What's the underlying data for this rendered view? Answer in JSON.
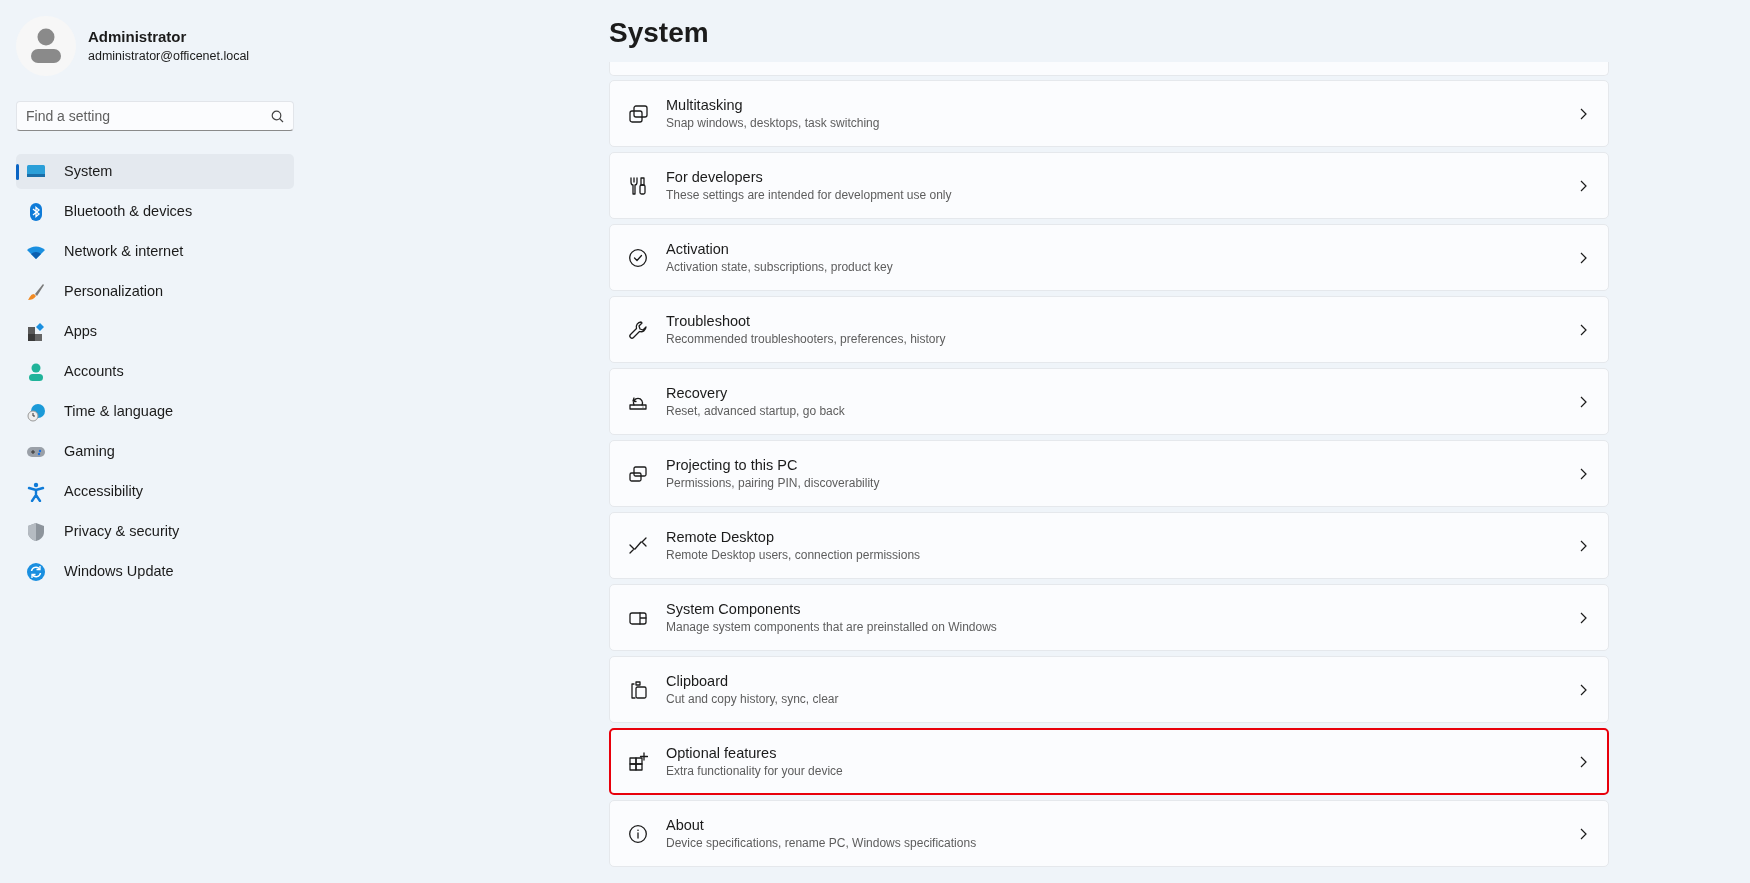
{
  "user": {
    "name": "Administrator",
    "email": "administrator@officenet.local"
  },
  "search": {
    "placeholder": "Find a setting"
  },
  "nav": [
    {
      "label": "System",
      "selected": true
    },
    {
      "label": "Bluetooth & devices",
      "selected": false
    },
    {
      "label": "Network & internet",
      "selected": false
    },
    {
      "label": "Personalization",
      "selected": false
    },
    {
      "label": "Apps",
      "selected": false
    },
    {
      "label": "Accounts",
      "selected": false
    },
    {
      "label": "Time & language",
      "selected": false
    },
    {
      "label": "Gaming",
      "selected": false
    },
    {
      "label": "Accessibility",
      "selected": false
    },
    {
      "label": "Privacy & security",
      "selected": false
    },
    {
      "label": "Windows Update",
      "selected": false
    }
  ],
  "page_title": "System",
  "settings": [
    {
      "title": "Multitasking",
      "description": "Snap windows, desktops, task switching",
      "highlighted": false
    },
    {
      "title": "For developers",
      "description": "These settings are intended for development use only",
      "highlighted": false
    },
    {
      "title": "Activation",
      "description": "Activation state, subscriptions, product key",
      "highlighted": false
    },
    {
      "title": "Troubleshoot",
      "description": "Recommended troubleshooters, preferences, history",
      "highlighted": false
    },
    {
      "title": "Recovery",
      "description": "Reset, advanced startup, go back",
      "highlighted": false
    },
    {
      "title": "Projecting to this PC",
      "description": "Permissions, pairing PIN, discoverability",
      "highlighted": false
    },
    {
      "title": "Remote Desktop",
      "description": "Remote Desktop users, connection permissions",
      "highlighted": false
    },
    {
      "title": "System Components",
      "description": "Manage system components that are preinstalled on Windows",
      "highlighted": false
    },
    {
      "title": "Clipboard",
      "description": "Cut and copy history, sync, clear",
      "highlighted": false
    },
    {
      "title": "Optional features",
      "description": "Extra functionality for your device",
      "highlighted": true
    },
    {
      "title": "About",
      "description": "Device specifications, rename PC, Windows specifications",
      "highlighted": false
    }
  ]
}
